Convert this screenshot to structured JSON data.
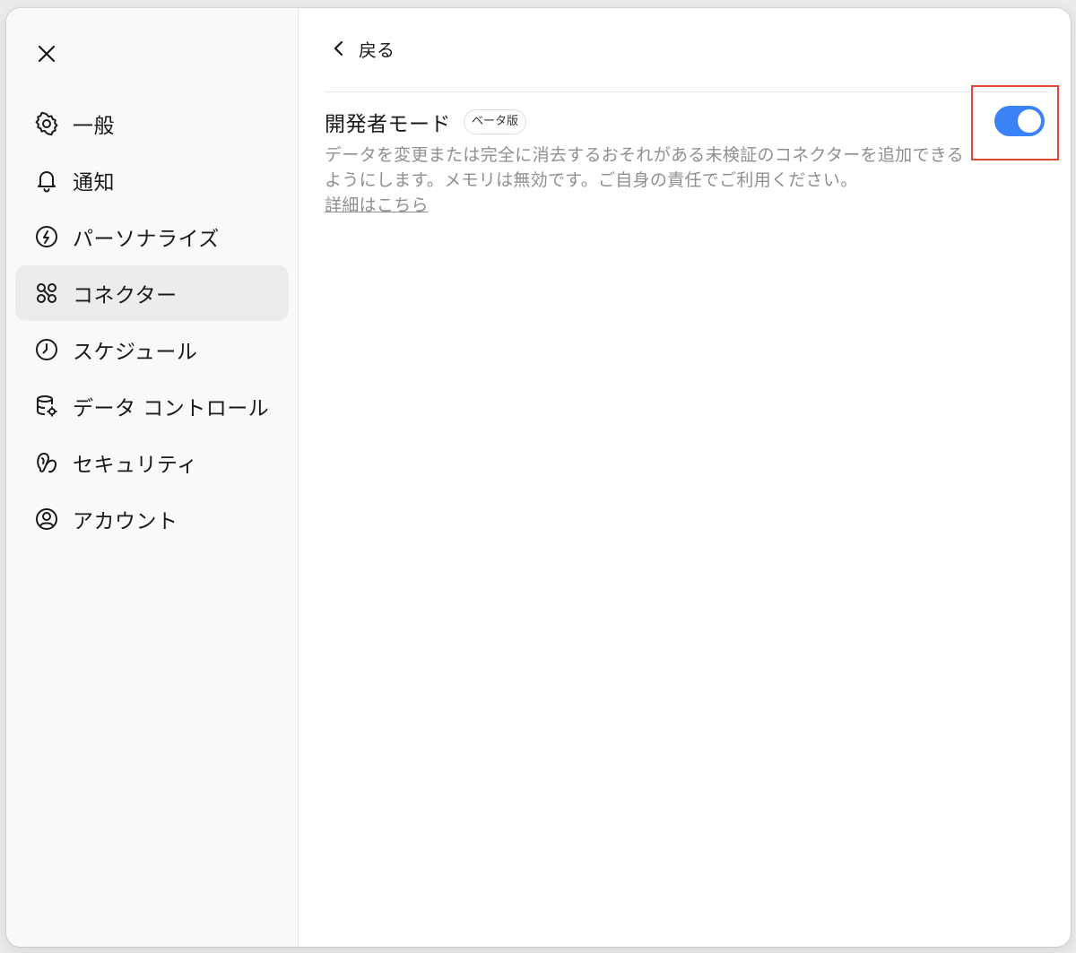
{
  "sidebar": {
    "close_icon": "close-icon",
    "items": [
      {
        "label": "一般",
        "icon": "gear-icon",
        "active": false
      },
      {
        "label": "通知",
        "icon": "bell-icon",
        "active": false
      },
      {
        "label": "パーソナライズ",
        "icon": "personalize-icon",
        "active": false
      },
      {
        "label": "コネクター",
        "icon": "connectors-icon",
        "active": true
      },
      {
        "label": "スケジュール",
        "icon": "clock-icon",
        "active": false
      },
      {
        "label": "データ コントロール",
        "icon": "data-controls-icon",
        "active": false
      },
      {
        "label": "セキュリティ",
        "icon": "security-icon",
        "active": false
      },
      {
        "label": "アカウント",
        "icon": "account-icon",
        "active": false
      }
    ]
  },
  "main": {
    "back_label": "戻る",
    "setting": {
      "title": "開発者モード",
      "badge": "ベータ版",
      "description": "データを変更または完全に消去するおそれがある未検証のコネクターを追加できるようにします。メモリは無効です。ご自身の責任でご利用ください。",
      "learn_more": "詳細はこちら",
      "enabled": true
    }
  },
  "colors": {
    "accent": "#3b82f6",
    "highlight_frame": "#e0482f",
    "active_nav_bg": "#ececec",
    "muted_text": "#8f8f8f"
  }
}
